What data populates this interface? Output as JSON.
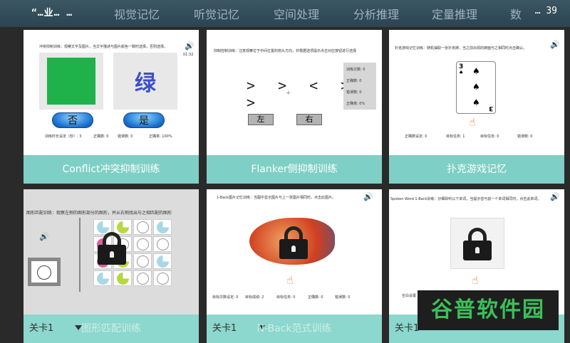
{
  "status_left": "“…业… …",
  "status_right": "… 39",
  "tabs": [
    "视觉记忆",
    "听觉记忆",
    "空间处理",
    "分析推理",
    "定量推理"
  ],
  "tab_partial": "数",
  "cards": [
    {
      "label": "Conflict冲突抑制训练",
      "instruction": "冲突抑制训练：观察文字及图片，当文字描述与图片颜色一致时选择，否则选择。",
      "time": "01:32",
      "word": "绿",
      "no_btn": "否",
      "yes_btn": "是",
      "stats": [
        "训练时长设定（秒）: 3",
        "正确数: 0",
        "错误数: 0",
        "正确率: 100%"
      ],
      "colors": {
        "square": "#1fb24a",
        "word": "#3b4fc8"
      }
    },
    {
      "label": "Flanker侧抑制训练",
      "instruction": "抑制控制训练：注意观察位于中间位置的箭头方向，并根据选项提示点击对应按钮进行选择",
      "arrows": "> > < > >",
      "left_btn": "左",
      "right_btn": "右",
      "stats": [
        "训练次数: 0",
        "正确数: 0",
        "错误数: 0",
        "正确率: 0%"
      ]
    },
    {
      "label": "扑克游戏记忆",
      "instruction": "扑克游戏记忆训练：随机抽取一张扑克牌，当之前出现的牌面与之相同时点击确认。",
      "card_rank": "3",
      "stats": [
        "正确数设定: 0",
        "目标任务: 1",
        "目标任务: 0",
        "错误数: 0"
      ]
    },
    {
      "instruction": "图形匹配训练：观察左侧的图形部分的图形，并从右侧找出与之相匹配的图形",
      "level_label": "关卡1",
      "label": "图形匹配训练",
      "pie_colors": [
        "#a8d8e8",
        "#b8d840",
        "#e060a0"
      ]
    },
    {
      "instruction": "1-Back图片记忆训练：当图中显示图片与上一张图片相同时，点击此图片。",
      "level_label": "关卡1",
      "label": "N-Back范式训练",
      "stats": [
        "目标次数设定: 0",
        "目标成绩: 2",
        "目标任务: 0",
        "正确数: 0",
        "错误数: 0"
      ]
    },
    {
      "instruction": "Spoken Word 1-Back训练：仔细聆听以下单词，当提示音与前一个单词相同时，点击此单词。",
      "level_label": "关卡1",
      "partial_text": "空白设置"
    }
  ],
  "watermark": "谷普软件园"
}
